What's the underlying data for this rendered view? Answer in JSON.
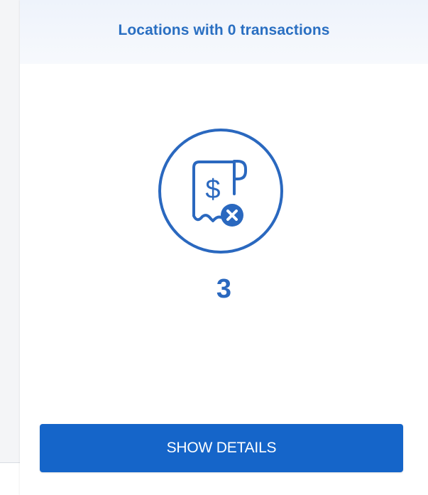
{
  "card": {
    "title": "Locations with 0 transactions",
    "icon": "receipt-cancel-icon",
    "value": "3",
    "button_label": "SHOW DETAILS"
  },
  "colors": {
    "accent": "#2a6fc2",
    "button": "#1565c9",
    "header_bg": "#eef3fb"
  }
}
